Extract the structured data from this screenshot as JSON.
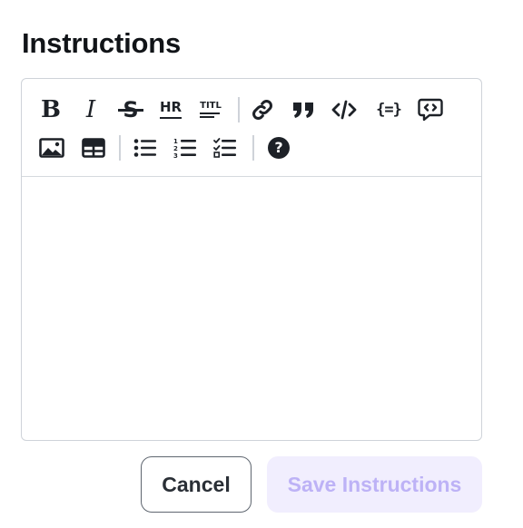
{
  "section": {
    "title": "Instructions"
  },
  "toolbar": {
    "row1": [
      {
        "name": "bold-icon",
        "label": "B"
      },
      {
        "name": "italic-icon",
        "label": "I"
      },
      {
        "name": "strikethrough-icon",
        "label": "S"
      },
      {
        "name": "horizontal-rule-icon",
        "label": "HR"
      },
      {
        "name": "title-icon",
        "label": "TITL"
      },
      {
        "name": "link-icon"
      },
      {
        "name": "quote-icon"
      },
      {
        "name": "code-icon",
        "label": "</>"
      },
      {
        "name": "variable-icon",
        "label": "{=}"
      },
      {
        "name": "embed-icon"
      }
    ],
    "row2": [
      {
        "name": "image-icon"
      },
      {
        "name": "table-icon"
      },
      {
        "name": "bullet-list-icon"
      },
      {
        "name": "numbered-list-icon"
      },
      {
        "name": "checklist-icon"
      },
      {
        "name": "help-icon",
        "label": "?"
      }
    ]
  },
  "editor": {
    "value": "",
    "placeholder": ""
  },
  "actions": {
    "cancel_label": "Cancel",
    "save_label": "Save Instructions",
    "save_enabled": false
  },
  "colors": {
    "text": "#111418",
    "border": "#cfd3d9",
    "save_bg": "#f1eefe",
    "save_text": "#bdb2f6",
    "cancel_border": "#5f6670"
  }
}
